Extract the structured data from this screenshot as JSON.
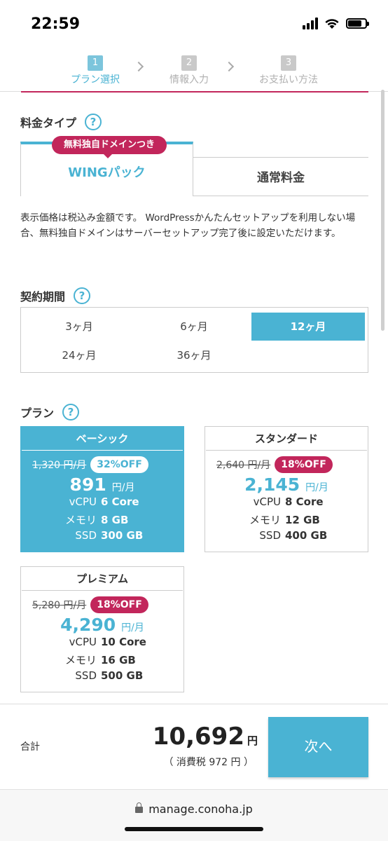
{
  "status_bar": {
    "time": "22:59"
  },
  "steps": [
    {
      "num": "1",
      "label": "プラン選択"
    },
    {
      "num": "2",
      "label": "情報入力"
    },
    {
      "num": "3",
      "label": "お支払い方法"
    }
  ],
  "pricing_type": {
    "title": "料金タイプ",
    "help": "?",
    "badge": "無料独自ドメインつき",
    "tabs": [
      "WINGパック",
      "通常料金"
    ]
  },
  "notice": "表示価格は税込み金額です。 WordPressかんたんセットアップを利用しない場合、無料独自ドメインはサーバーセットアップ完了後に設定いただけます。",
  "period": {
    "title": "契約期間",
    "help": "?",
    "options": [
      "3ヶ月",
      "6ヶ月",
      "12ヶ月",
      "24ヶ月",
      "36ヶ月"
    ],
    "selected": "12ヶ月"
  },
  "plan": {
    "title": "プラン",
    "help": "?",
    "items": [
      {
        "name": "ベーシック",
        "old_price": "1,320 円/月",
        "discount": "32%OFF",
        "price": "891",
        "unit": "円/月",
        "specs": [
          {
            "k": "vCPU",
            "v": "6 Core"
          },
          {
            "k": "メモリ",
            "v": "8 GB"
          },
          {
            "k": "SSD",
            "v": "300 GB"
          }
        ]
      },
      {
        "name": "スタンダード",
        "old_price": "2,640 円/月",
        "discount": "18%OFF",
        "price": "2,145",
        "unit": "円/月",
        "specs": [
          {
            "k": "vCPU",
            "v": "8 Core"
          },
          {
            "k": "メモリ",
            "v": "12 GB"
          },
          {
            "k": "SSD",
            "v": "400 GB"
          }
        ]
      },
      {
        "name": "プレミアム",
        "old_price": "5,280 円/月",
        "discount": "18%OFF",
        "price": "4,290",
        "unit": "円/月",
        "specs": [
          {
            "k": "vCPU",
            "v": "10 Core"
          },
          {
            "k": "メモリ",
            "v": "16 GB"
          },
          {
            "k": "SSD",
            "v": "500 GB"
          }
        ]
      }
    ]
  },
  "footer": {
    "sum_label": "合計",
    "total": "10,692",
    "unit": "円",
    "tax": "（ 消費税 972 円 ）",
    "next_label": "次へ"
  },
  "browser": {
    "url": "manage.conoha.jp"
  },
  "colors": {
    "accent": "#4ab3d3",
    "badge": "#c2265b"
  }
}
